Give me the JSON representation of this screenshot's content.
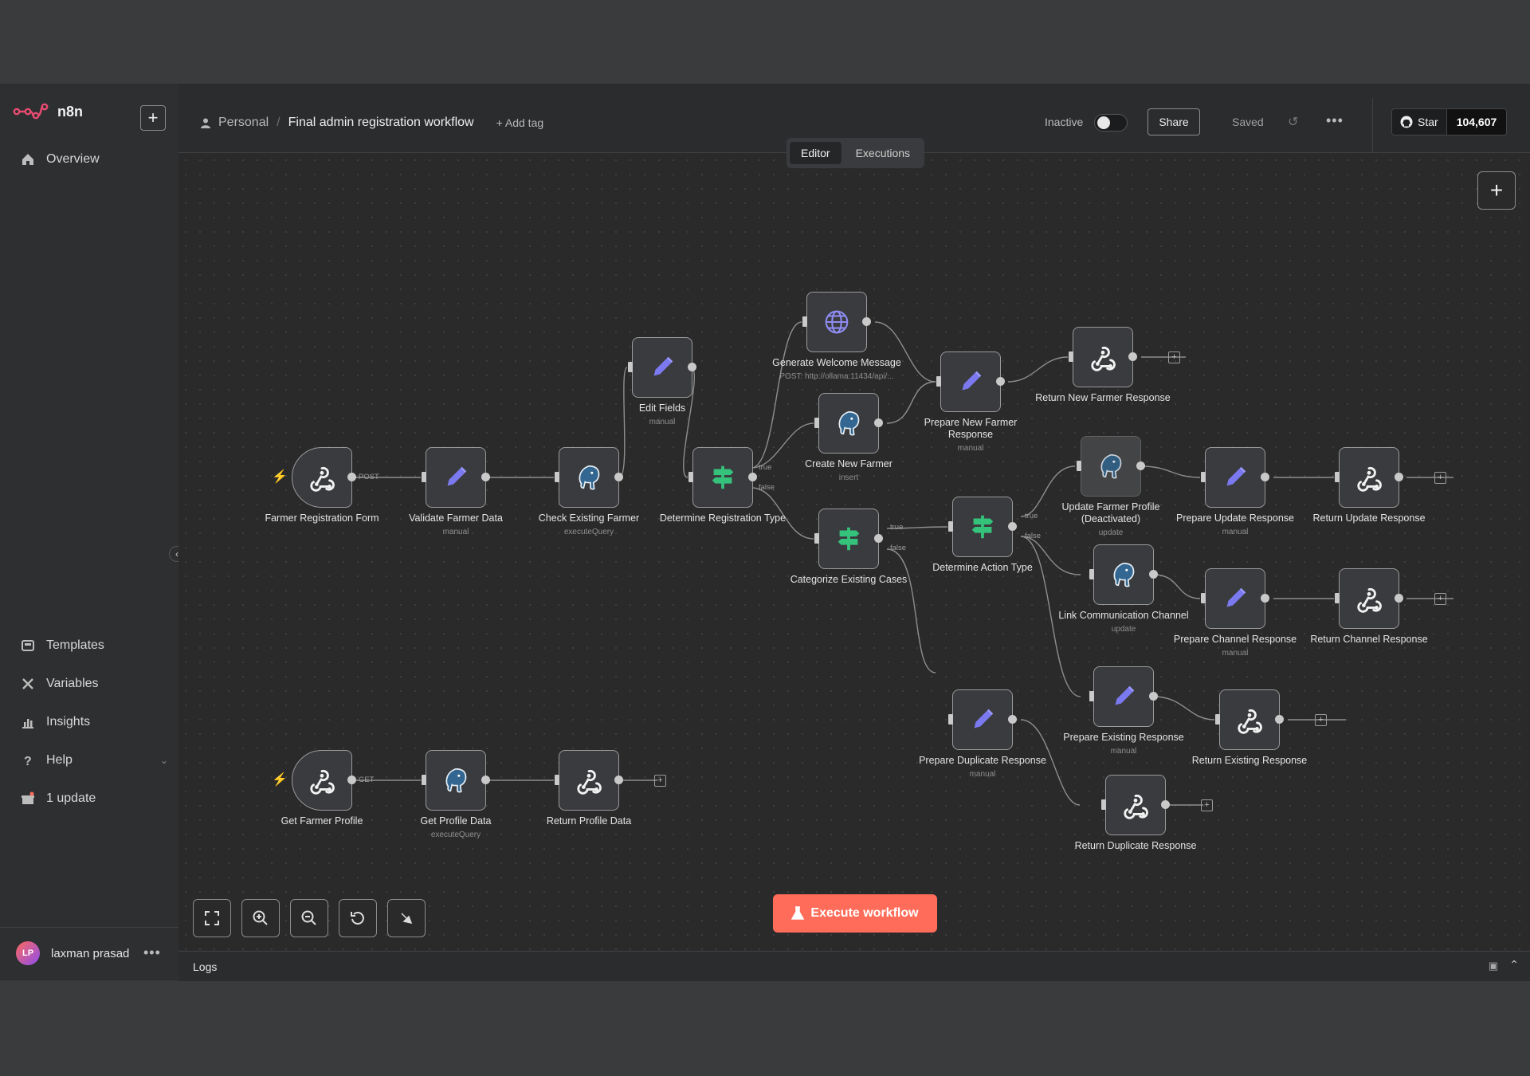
{
  "app": {
    "name": "n8n"
  },
  "sidebar": {
    "new_button": "+",
    "top_items": [
      {
        "label": "Overview",
        "icon": "home-icon"
      }
    ],
    "bottom_items": [
      {
        "label": "Templates",
        "icon": "templates-icon"
      },
      {
        "label": "Variables",
        "icon": "variables-icon"
      },
      {
        "label": "Insights",
        "icon": "insights-icon"
      },
      {
        "label": "Help",
        "icon": "help-icon"
      },
      {
        "label": "1 update",
        "icon": "gift-icon"
      }
    ],
    "user": {
      "initials": "LP",
      "name": "laxman prasad",
      "more": "•••"
    }
  },
  "header": {
    "project": "Personal",
    "separator": "/",
    "workflow_name": "Final admin registration workflow",
    "add_tag": "+ Add tag",
    "status_label": "Inactive",
    "active": false,
    "share_label": "Share",
    "saved_label": "Saved",
    "more": "•••",
    "github": {
      "star_label": "Star",
      "count": "104,607"
    },
    "tabs": [
      {
        "label": "Editor",
        "active": true
      },
      {
        "label": "Executions",
        "active": false
      }
    ]
  },
  "canvas": {
    "nodes": [
      {
        "label": "Farmer Registration Form",
        "sub": "",
        "icon": "webhook-icon"
      },
      {
        "label": "Validate Farmer Data",
        "sub": "manual",
        "icon": "pencil-icon"
      },
      {
        "label": "Check Existing Farmer",
        "sub": "executeQuery",
        "icon": "postgres-icon"
      },
      {
        "label": "Edit Fields",
        "sub": "manual",
        "icon": "pencil-icon"
      },
      {
        "label": "Determine Registration Type",
        "sub": "",
        "icon": "switch-icon"
      },
      {
        "label": "Generate Welcome Message",
        "sub": "POST: http://ollama:11434/api/...",
        "icon": "globe-icon"
      },
      {
        "label": "Create New Farmer",
        "sub": "insert",
        "icon": "postgres-icon"
      },
      {
        "label": "Prepare New Farmer Response",
        "sub": "manual",
        "icon": "pencil-icon"
      },
      {
        "label": "Return New Farmer Response",
        "sub": "",
        "icon": "webhook-icon"
      },
      {
        "label": "Categorize Existing Cases",
        "sub": "",
        "icon": "switch-icon"
      },
      {
        "label": "Determine Action Type",
        "sub": "",
        "icon": "switch-icon"
      },
      {
        "label": "Update Farmer Profile (Deactivated)",
        "sub": "update",
        "icon": "postgres-icon"
      },
      {
        "label": "Prepare Update Response",
        "sub": "manual",
        "icon": "pencil-icon"
      },
      {
        "label": "Return Update Response",
        "sub": "",
        "icon": "webhook-icon"
      },
      {
        "label": "Link Communication Channel",
        "sub": "update",
        "icon": "postgres-icon"
      },
      {
        "label": "Prepare Channel Response",
        "sub": "manual",
        "icon": "pencil-icon"
      },
      {
        "label": "Return Channel Response",
        "sub": "",
        "icon": "webhook-icon"
      },
      {
        "label": "Prepare Existing Response",
        "sub": "manual",
        "icon": "pencil-icon"
      },
      {
        "label": "Return Existing Response",
        "sub": "",
        "icon": "webhook-icon"
      },
      {
        "label": "Prepare Duplicate Response",
        "sub": "manual",
        "icon": "pencil-icon"
      },
      {
        "label": "Return Duplicate Response",
        "sub": "",
        "icon": "webhook-icon"
      },
      {
        "label": "Get Farmer Profile",
        "sub": "",
        "icon": "webhook-icon"
      },
      {
        "label": "Get Profile Data",
        "sub": "executeQuery",
        "icon": "postgres-icon"
      },
      {
        "label": "Return Profile Data",
        "sub": "",
        "icon": "webhook-icon"
      }
    ],
    "edge_labels": {
      "post": "POST",
      "get": "GET",
      "true": "true",
      "false": "false"
    },
    "execute_label": "Execute workflow",
    "add_node": "+"
  },
  "logs": {
    "label": "Logs"
  }
}
